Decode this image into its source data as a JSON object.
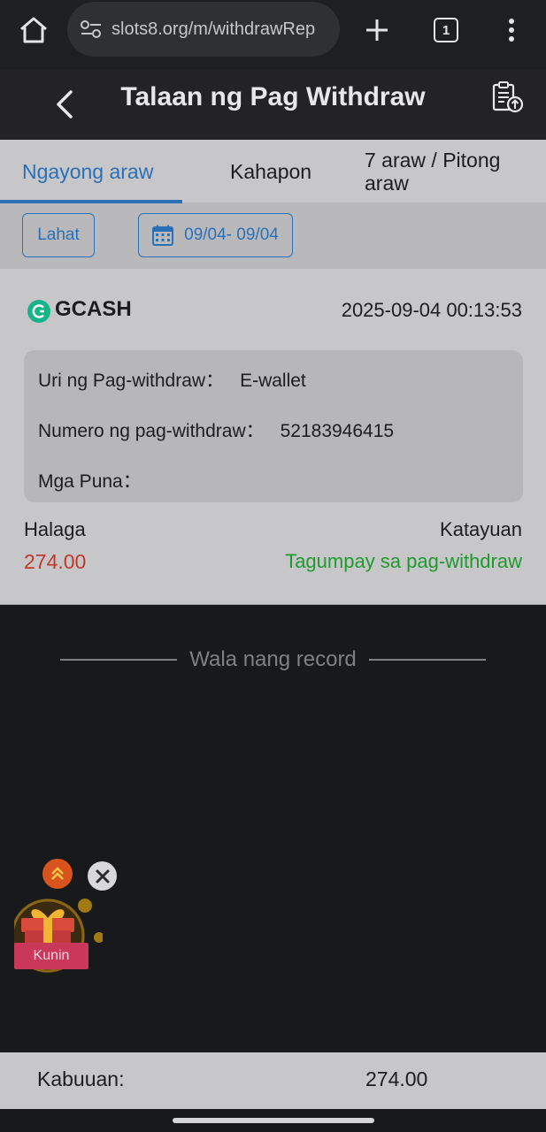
{
  "browser": {
    "url": "slots8.org/m/withdrawRep",
    "tab_count": "1"
  },
  "header": {
    "title": "Talaan ng Pag Withdraw"
  },
  "tabs": [
    {
      "label": "Ngayong araw",
      "active": true
    },
    {
      "label": "Kahapon",
      "active": false
    },
    {
      "label": "7 araw / Pitong araw",
      "active": false
    }
  ],
  "filters": {
    "all_label": "Lahat",
    "date_range": "09/04- 09/04"
  },
  "record": {
    "method": "GCASH",
    "datetime": "2025-09-04 00:13:53",
    "type_label": "Uri ng Pag-withdraw：",
    "type_value": "E-wallet",
    "number_label": "Numero ng pag-withdraw：",
    "number_value": "52183946415",
    "remarks_label": "Mga Puna：",
    "remarks_value": "",
    "amount_label": "Halaga",
    "amount_value": "274.00",
    "status_label": "Katayuan",
    "status_value": "Tagumpay sa pag-withdraw"
  },
  "list_end": {
    "text": "Wala nang record"
  },
  "gift_widget": {
    "label": "Kunin"
  },
  "footer": {
    "total_label": "Kabuuan:",
    "total_value": "274.00"
  },
  "colors": {
    "accent": "#2a70b8",
    "amount": "#c0392b",
    "success": "#1e9a2e",
    "gcash": "#17b48a"
  }
}
